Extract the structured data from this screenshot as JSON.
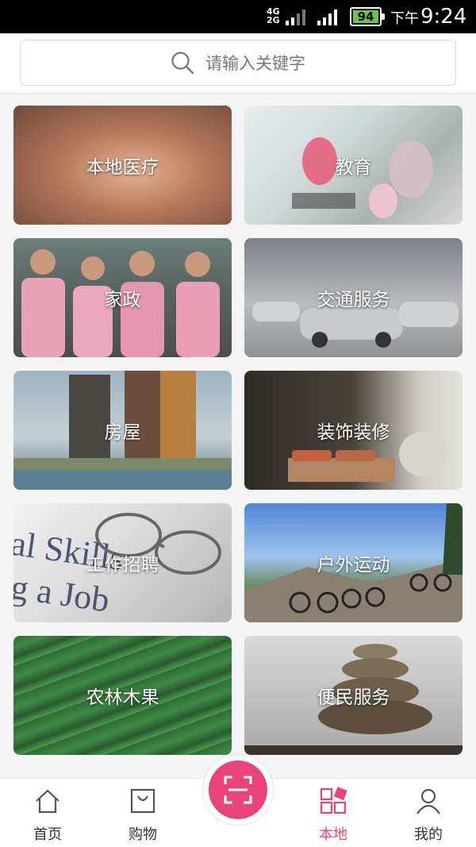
{
  "status_bar": {
    "network": "4G\n2G",
    "battery": "94",
    "time_period": "下午",
    "time": "9:24"
  },
  "search": {
    "placeholder": "请输入关键字",
    "icon": "search-icon"
  },
  "categories": [
    {
      "label": "本地医疗"
    },
    {
      "label": "教育"
    },
    {
      "label": "家政"
    },
    {
      "label": "交通服务"
    },
    {
      "label": "房屋"
    },
    {
      "label": "装饰装修"
    },
    {
      "label": "工作招聘"
    },
    {
      "label": "户外运动"
    },
    {
      "label": "农林木果"
    },
    {
      "label": "便民服务"
    }
  ],
  "bottom_nav": {
    "items": [
      {
        "label": "首页",
        "icon": "home-icon"
      },
      {
        "label": "购物",
        "icon": "shopping-bag-icon"
      },
      {
        "label": "本地",
        "icon": "local-grid-icon"
      },
      {
        "label": "我的",
        "icon": "user-icon"
      }
    ],
    "active": "本地",
    "scan_icon": "scan-icon"
  },
  "colors": {
    "accent": "#e8437a",
    "status_bar": "#000000",
    "battery": "#6cc24a"
  }
}
